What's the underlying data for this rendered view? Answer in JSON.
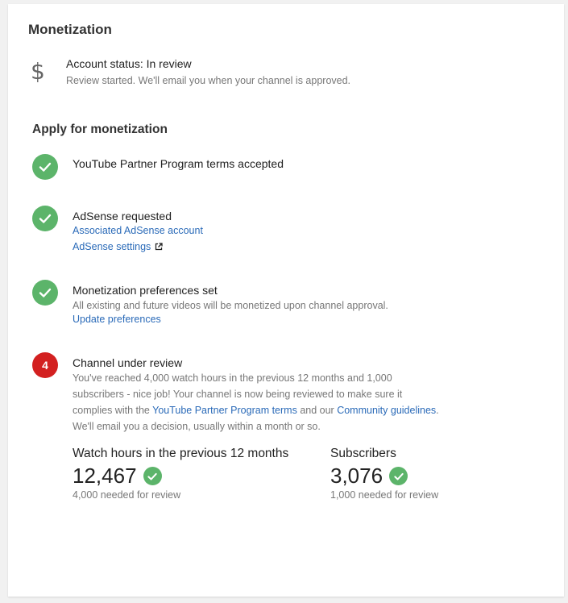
{
  "header": {
    "title": "Monetization"
  },
  "account": {
    "icon": "dollar-icon",
    "status": "Account status: In review",
    "detail": "Review started. We'll email you when your channel is approved."
  },
  "apply": {
    "heading": "Apply for monetization",
    "steps": {
      "ypp": {
        "title": "YouTube Partner Program terms accepted"
      },
      "adsense": {
        "title": "AdSense requested",
        "link1": "Associated AdSense account",
        "link2": "AdSense settings"
      },
      "prefs": {
        "title": "Monetization preferences set",
        "text": "All existing and future videos will be monetized upon channel approval.",
        "link": "Update preferences"
      },
      "review": {
        "number": "4",
        "title": "Channel under review",
        "line1": "You've reached 4,000 watch hours in the previous 12 months and 1,000",
        "line2": "subscribers - nice job! Your channel is now being reviewed to make sure it",
        "line3_prefix": "complies with the ",
        "line3_link1": "YouTube Partner Program terms",
        "line3_mid": " and our ",
        "line3_link2": "Community guidelines",
        "line3_suffix": ".",
        "line4": "We'll email you a decision, usually within a month or so."
      }
    }
  },
  "stats": {
    "watch": {
      "label": "Watch hours in the previous 12 months",
      "value": "12,467",
      "note": "4,000 needed for review"
    },
    "subs": {
      "label": "Subscribers",
      "value": "3,076",
      "note": "1,000 needed for review"
    }
  },
  "colors": {
    "check": "#5cb46a",
    "step_number": "#d32020",
    "link": "#2a6ab8"
  }
}
